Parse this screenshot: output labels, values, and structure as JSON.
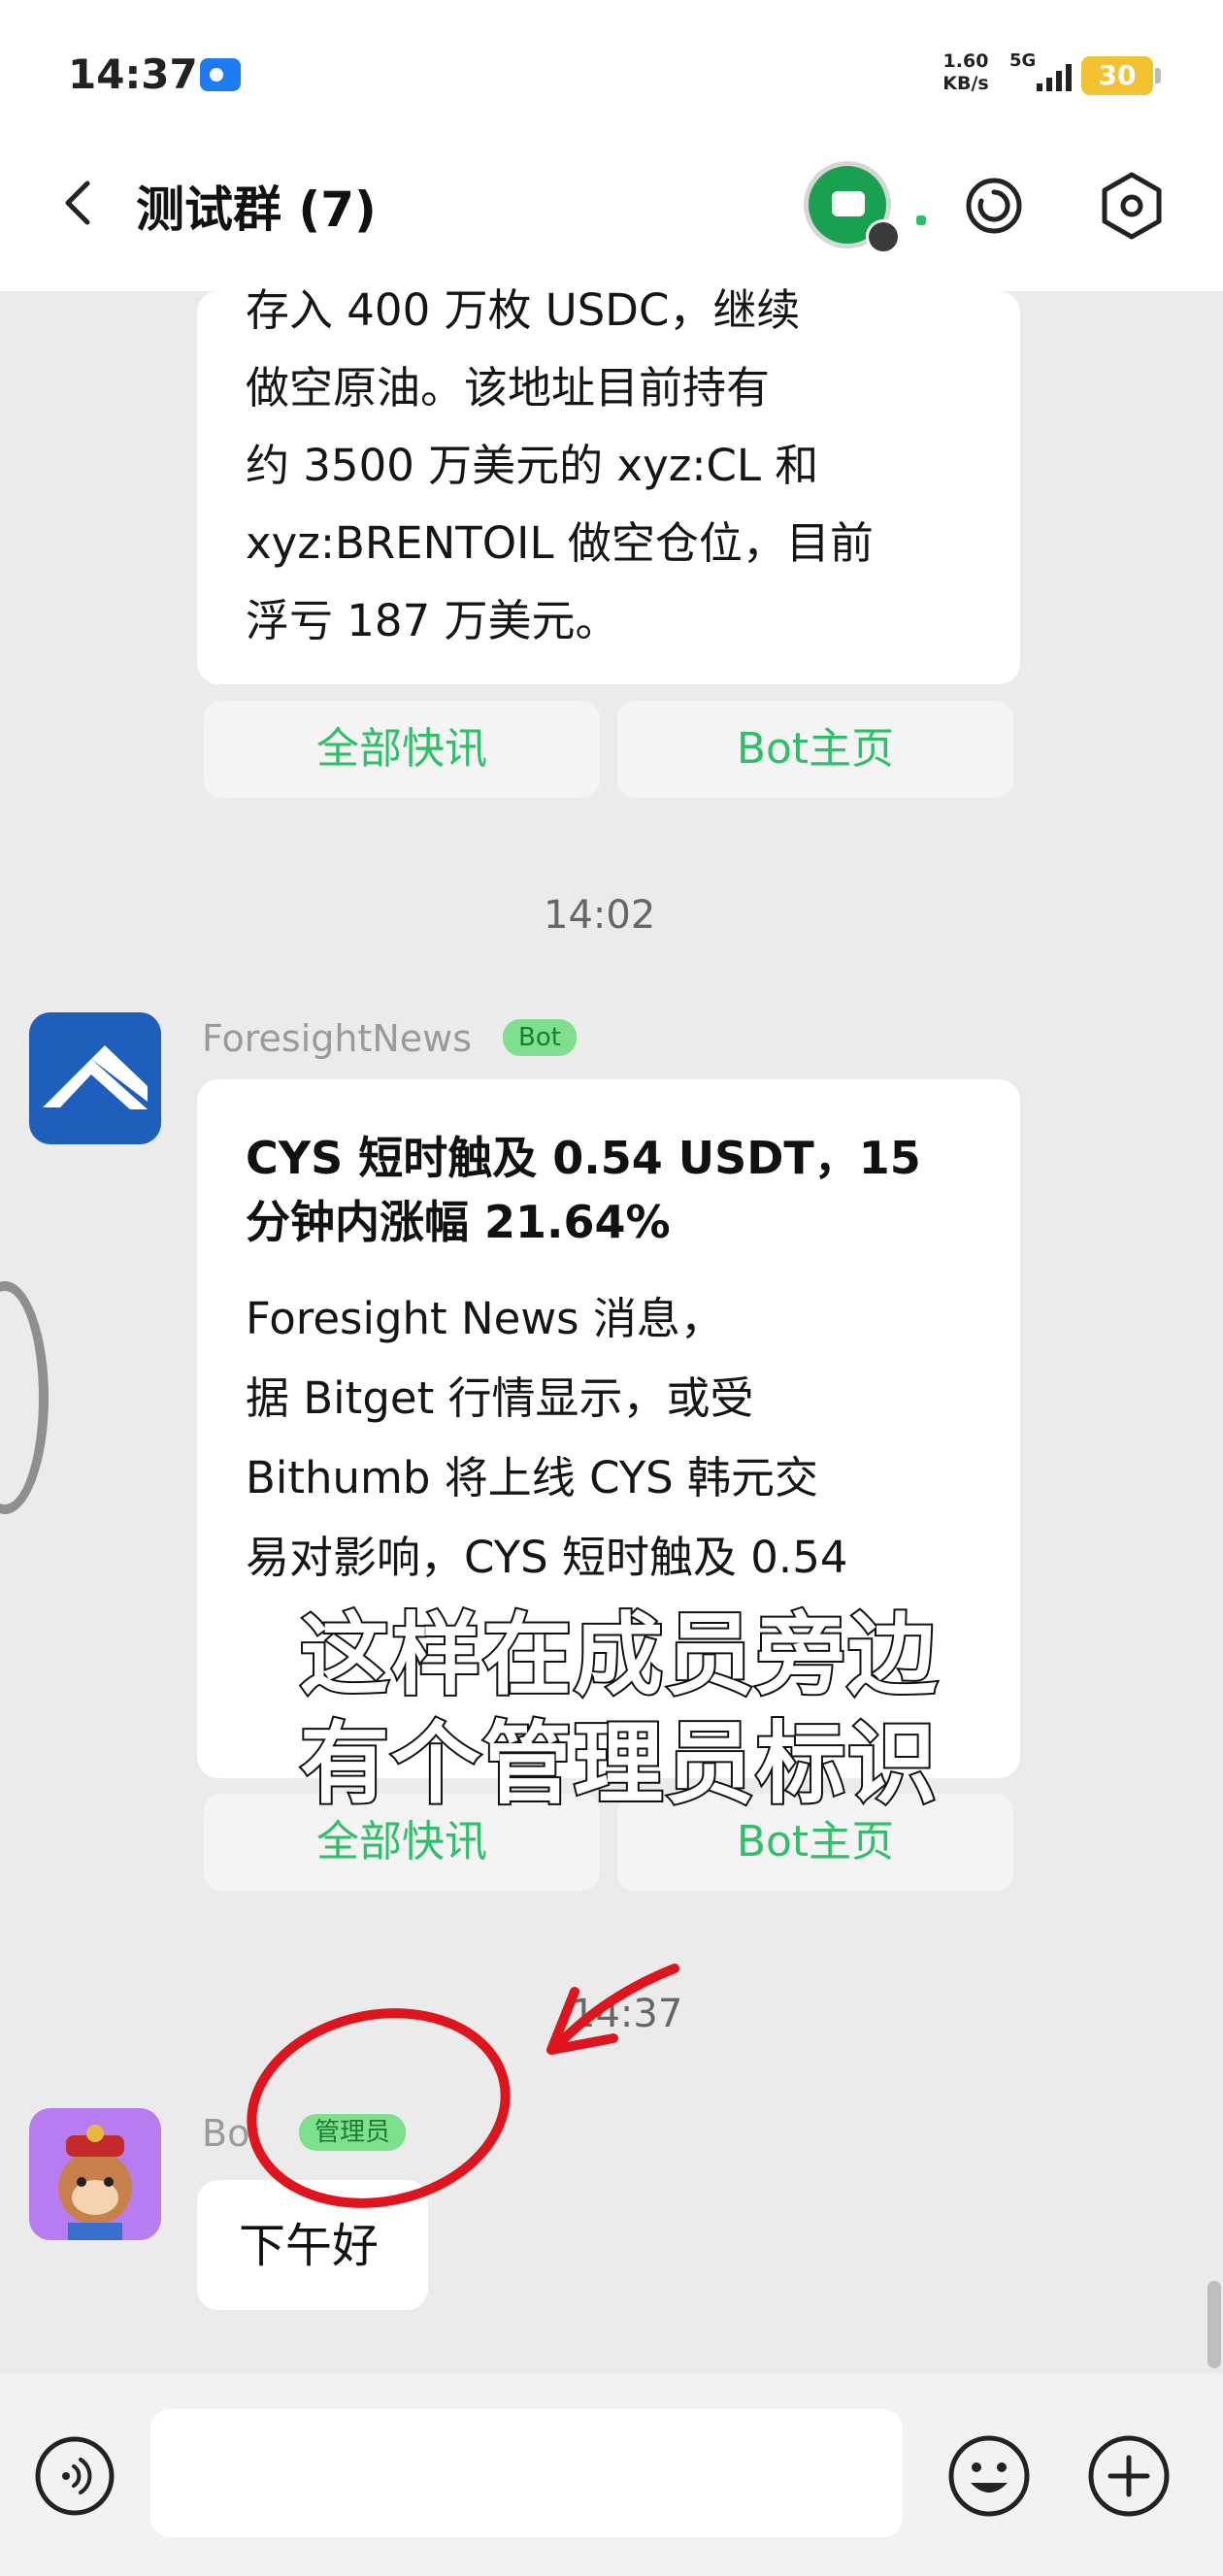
{
  "status_bar": {
    "time": "14:37",
    "net_speed_value": "1.60",
    "net_speed_unit": "KB/s",
    "network": "5G",
    "battery": "30"
  },
  "header": {
    "title": "测试群 (7)"
  },
  "messages": [
    {
      "text_lines": [
        "存入 400 万枚 USDC，继续",
        "做空原油。该地址目前持有",
        "约 3500 万美元的 xyz:CL 和",
        "xyz:BRENTOIL 做空仓位，目前",
        "浮亏 187 万美元。"
      ],
      "buttons": [
        "全部快讯",
        "Bot主页"
      ]
    },
    {
      "timestamp": "14:02",
      "sender": "ForesightNews",
      "badge": "Bot",
      "title_lines": [
        "CYS 短时触及 0.54 USDT，15",
        "分钟内涨幅 21.64%"
      ],
      "body_lines": [
        "Foresight News 消息，",
        "据 Bitget 行情显示，或受",
        "Bithumb 将上线 CYS 韩元交",
        "易对影响，CYS 短时触及 0.54"
      ],
      "buttons": [
        "全部快讯",
        "Bot主页"
      ]
    },
    {
      "timestamp": "14:37",
      "sender": "Bo",
      "badge": "管理员",
      "text": "下午好"
    }
  ],
  "overlay_caption": [
    "这样在成员旁边",
    "有个管理员标识"
  ],
  "colors": {
    "accent_green": "#2fbf68",
    "annotation_red": "#e0141c",
    "background": "#ebebeb",
    "battery": "#f2c230"
  },
  "icons": {
    "back": "chevron-left-icon",
    "refresh": "refresh-icon",
    "settings": "hexagon-gear-icon",
    "voice": "voice-icon",
    "emoji": "emoji-icon",
    "plus": "plus-icon"
  }
}
